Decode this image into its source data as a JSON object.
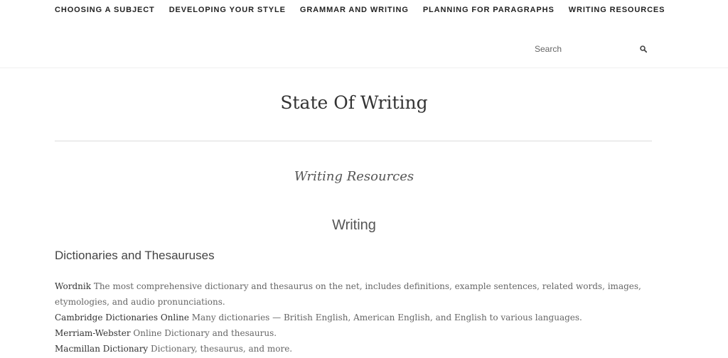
{
  "nav": {
    "items": [
      {
        "label": "CHOOSING A SUBJECT"
      },
      {
        "label": "DEVELOPING YOUR STYLE"
      },
      {
        "label": "GRAMMAR AND WRITING"
      },
      {
        "label": "PLANNING FOR PARAGRAPHS"
      },
      {
        "label": "WRITING RESOURCES"
      }
    ]
  },
  "search": {
    "placeholder": "Search",
    "icon": "search-icon"
  },
  "site": {
    "title": "State Of Writing"
  },
  "page": {
    "title": "Writing Resources",
    "section_heading": "Writing",
    "sub_heading": "Dictionaries and Thesauruses",
    "entries": [
      {
        "link": "Wordnik",
        "text": " The most comprehensive dictionary and thesaurus on the net, includes definitions, example sentences, related words, images, etymologies, and audio pronunciations."
      },
      {
        "link": "Cambridge Dictionaries Online",
        "text": " Many dictionaries — British English, American English, and English to various languages."
      },
      {
        "link": "Merriam-Webster",
        "text": " Online Dictionary and thesaurus."
      },
      {
        "link": "Macmillan Dictionary",
        "text": " Dictionary, thesaurus, and more."
      }
    ]
  }
}
